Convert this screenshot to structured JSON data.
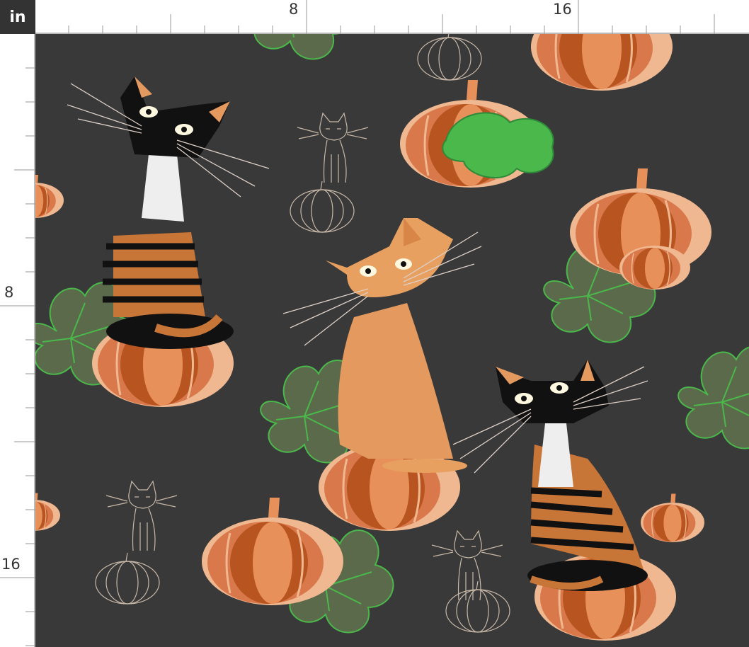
{
  "ruler": {
    "unit": "in",
    "top_labels": [
      "8",
      "16"
    ],
    "left_labels": [
      "8",
      "16"
    ]
  },
  "fabric": {
    "background": "#393939",
    "motifs": [
      "cat",
      "pumpkin",
      "pumpkin-leaf"
    ],
    "colors": {
      "pumpkin_dark": "#b8541f",
      "pumpkin_mid": "#d9784a",
      "pumpkin_light": "#f0b890",
      "cat_orange": "#e49a5e",
      "cat_black": "#111111",
      "leaf_green": "#4bb84b"
    }
  }
}
